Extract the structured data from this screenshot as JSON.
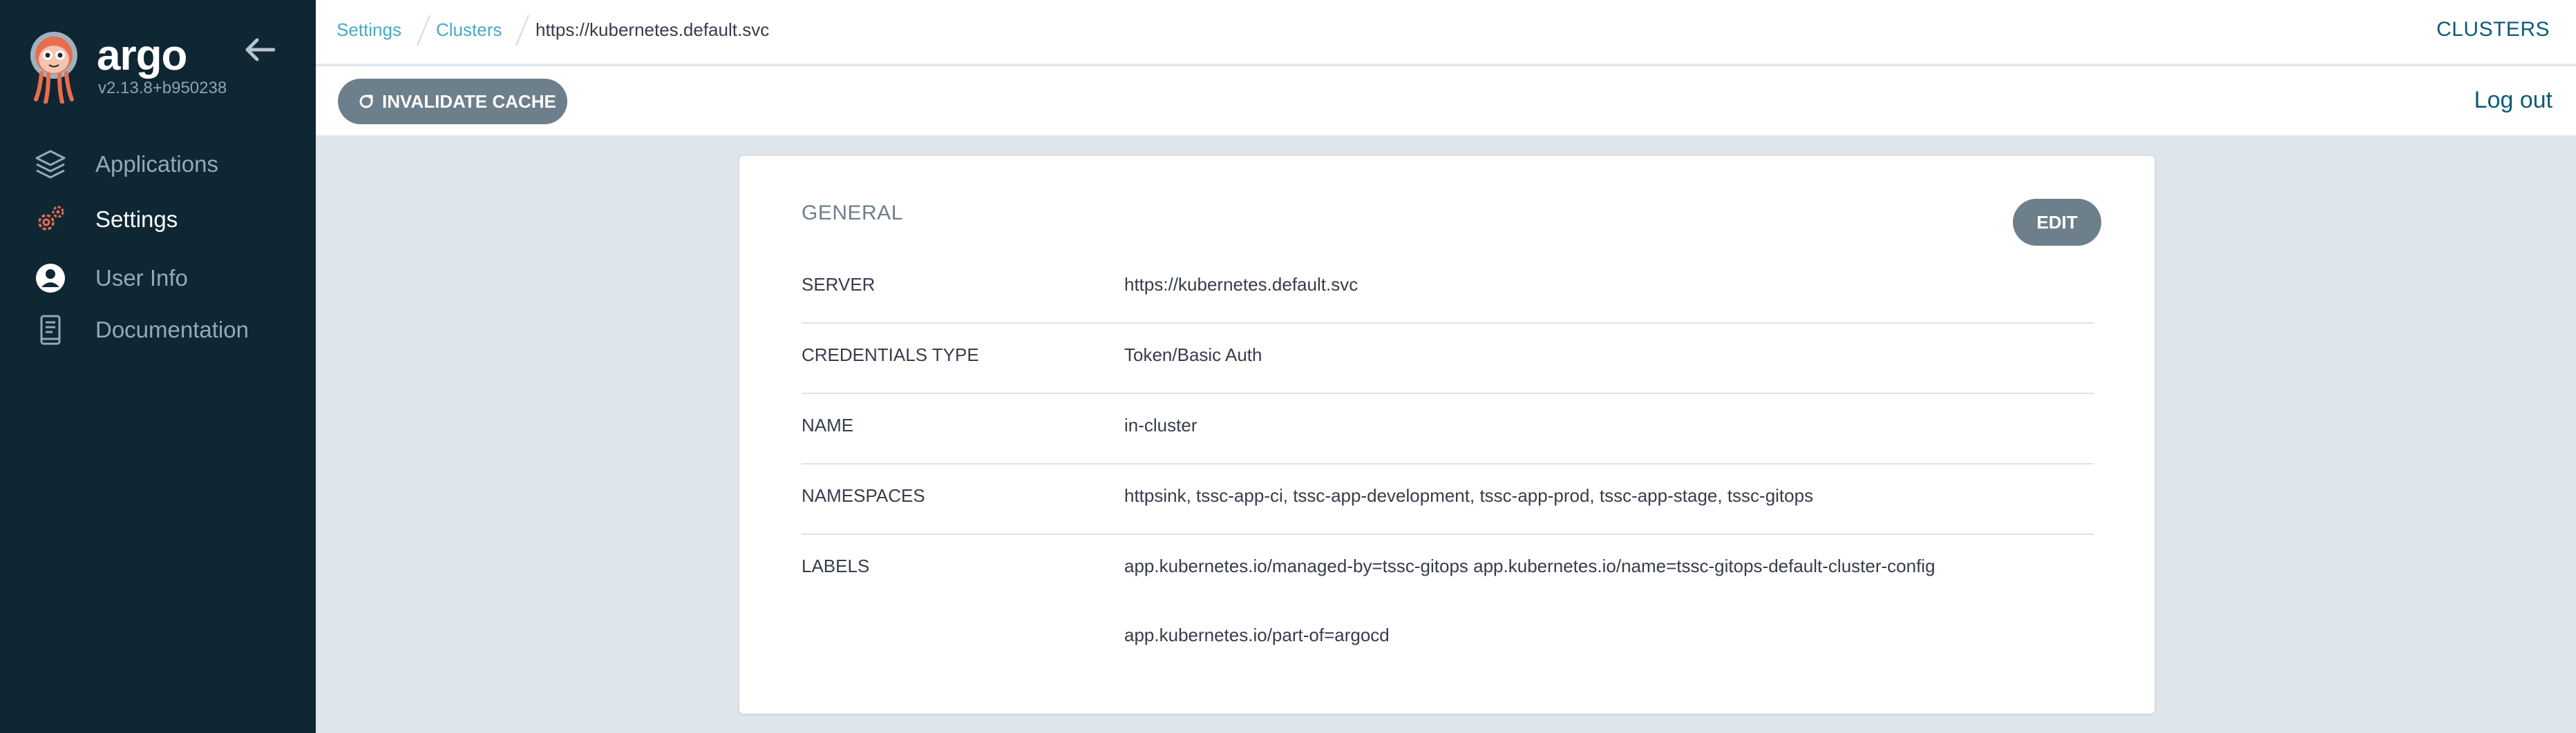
{
  "sidebar": {
    "brand": "argo",
    "version": "v2.13.8+b950238",
    "items": [
      {
        "label": "Applications",
        "icon": "stack-icon"
      },
      {
        "label": "Settings",
        "icon": "gears-icon"
      },
      {
        "label": "User Info",
        "icon": "user-circle-icon"
      },
      {
        "label": "Documentation",
        "icon": "book-icon"
      }
    ],
    "active_item": "Settings"
  },
  "breadcrumb": {
    "items": [
      "Settings",
      "Clusters"
    ],
    "current": "https://kubernetes.default.svc"
  },
  "header": {
    "title": "CLUSTERS",
    "logout_label": "Log out"
  },
  "toolbar": {
    "invalidate_label": "INVALIDATE CACHE"
  },
  "card": {
    "title": "GENERAL",
    "edit_label": "EDIT",
    "fields": [
      {
        "key": "SERVER",
        "value": "https://kubernetes.default.svc"
      },
      {
        "key": "CREDENTIALS TYPE",
        "value": "Token/Basic Auth"
      },
      {
        "key": "NAME",
        "value": "in-cluster"
      },
      {
        "key": "NAMESPACES",
        "value": "httpsink, tssc-app-ci, tssc-app-development, tssc-app-prod, tssc-app-stage, tssc-gitops"
      }
    ],
    "labels_key": "LABELS",
    "labels": [
      "app.kubernetes.io/managed-by=tssc-gitops app.kubernetes.io/name=tssc-gitops-default-cluster-config",
      "app.kubernetes.io/part-of=argocd"
    ]
  },
  "colors": {
    "sidebar_bg": "#0f2733",
    "accent": "#0d5a78",
    "link": "#4aa8c6",
    "button": "#6d7f8b",
    "logo_orange": "#e96d4c"
  }
}
